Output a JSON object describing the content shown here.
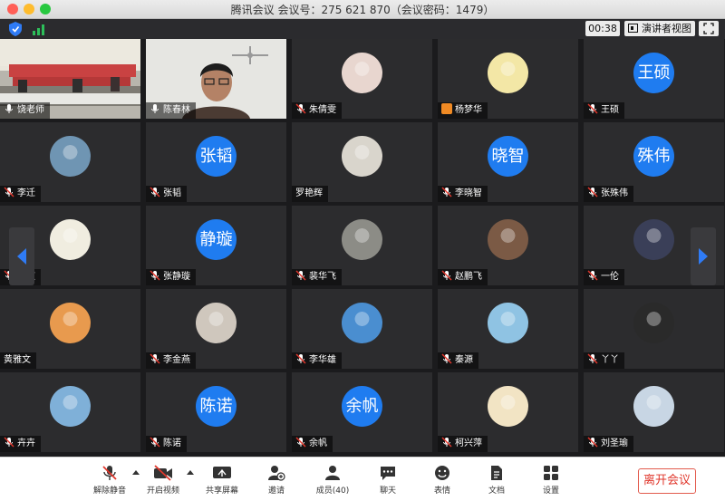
{
  "window": {
    "title": "腾讯会议 会议号：275 621 870（会议密码：1479）"
  },
  "toolbar": {
    "timer": "00:38",
    "speaker_view": "演讲者视图"
  },
  "participants": [
    {
      "name": "饶老师",
      "type": "video-room"
    },
    {
      "name": "陈春林",
      "type": "video-face"
    },
    {
      "name": "朱倩雯",
      "type": "photo",
      "color": "#e8d6cf"
    },
    {
      "name": "杨梦华",
      "type": "photo",
      "color": "#f3e7a6"
    },
    {
      "name": "王硕",
      "type": "text",
      "initials": "王硕"
    },
    {
      "name": "李迁",
      "type": "photo",
      "color": "#6f95b3"
    },
    {
      "name": "张韬",
      "type": "text",
      "initials": "张韬"
    },
    {
      "name": "罗艳辉",
      "type": "photo",
      "color": "#d9d5cc"
    },
    {
      "name": "李晓智",
      "type": "text",
      "initials": "晓智"
    },
    {
      "name": "张殊伟",
      "type": "text",
      "initials": "殊伟"
    },
    {
      "name": "金爽",
      "type": "photo",
      "color": "#f0ede0"
    },
    {
      "name": "张静璇",
      "type": "text",
      "initials": "静璇"
    },
    {
      "name": "裴华飞",
      "type": "photo",
      "color": "#8c8c86"
    },
    {
      "name": "赵鹏飞",
      "type": "photo",
      "color": "#7b5a45"
    },
    {
      "name": "一伦",
      "type": "photo",
      "color": "#3a3f58"
    },
    {
      "name": "黄雅文",
      "type": "photo",
      "color": "#e89a4e"
    },
    {
      "name": "李金燕",
      "type": "photo",
      "color": "#cfc7bd"
    },
    {
      "name": "李华雄",
      "type": "photo",
      "color": "#4a8ed0"
    },
    {
      "name": "秦源",
      "type": "photo",
      "color": "#8fc3e3"
    },
    {
      "name": "丫丫",
      "type": "photo",
      "color": "#2a2a2a"
    },
    {
      "name": "卉卉",
      "type": "photo",
      "color": "#7fb0d8"
    },
    {
      "name": "陈诺",
      "type": "text",
      "initials": "陈诺"
    },
    {
      "name": "余帆",
      "type": "text",
      "initials": "余帆"
    },
    {
      "name": "柯兴萍",
      "type": "photo",
      "color": "#f2e4c4"
    },
    {
      "name": "刘圣瑜",
      "type": "photo",
      "color": "#c8d6e4"
    }
  ],
  "controls": {
    "mute": "解除静音",
    "video": "开启视频",
    "share": "共享屏幕",
    "invite": "邀请",
    "members": "成员(40)",
    "chat": "聊天",
    "reactions": "表情",
    "docs": "文档",
    "settings": "设置",
    "leave": "离开会议"
  },
  "colors": {
    "avatar_blue": "#1f7cf0",
    "leave_red": "#e0362b",
    "tile_bg": "#2c2c2e"
  }
}
